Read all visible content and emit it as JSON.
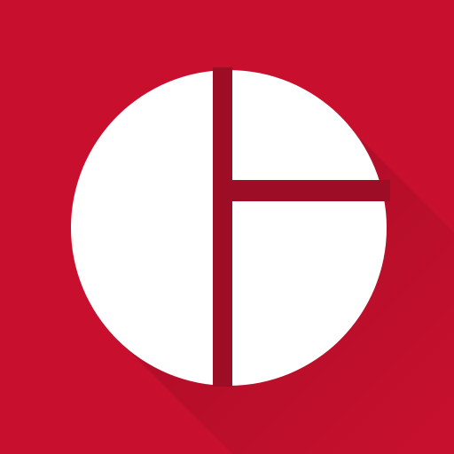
{
  "icon": {
    "name": "app-logo-icon",
    "background_color": "#c8102e",
    "shadow_color": "#8a0a20",
    "mark_color": "#ffffff",
    "gap_color": "#9e0d26"
  }
}
